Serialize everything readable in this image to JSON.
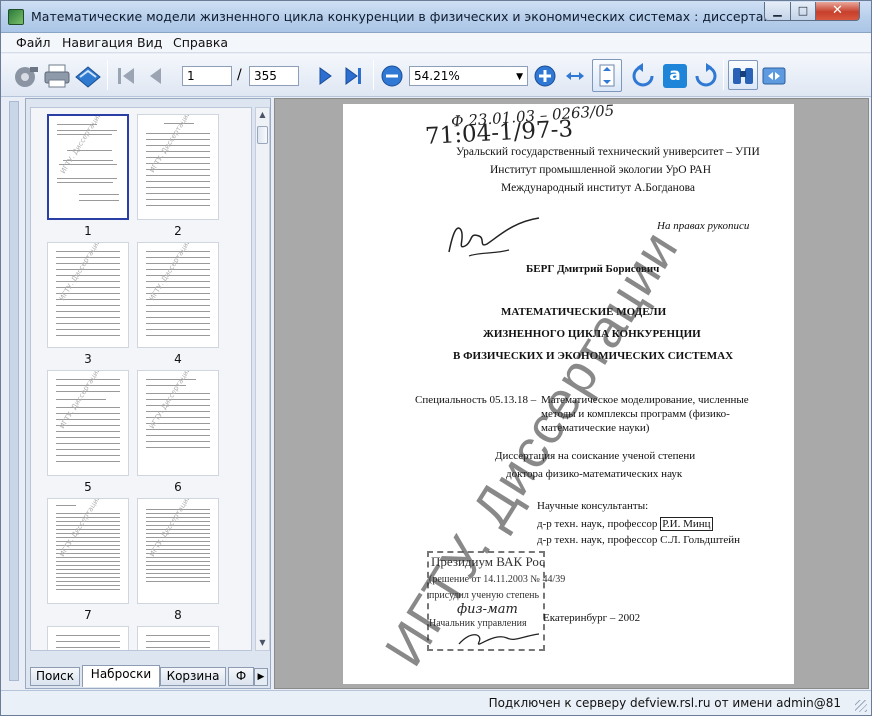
{
  "window": {
    "title": "Математические модели жизненного цикла конкуренции в физических и экономических системах : диссертация ... доктора физи..."
  },
  "menu": {
    "items": [
      "Файл",
      "Навигация",
      "Вид",
      "Справка"
    ]
  },
  "toolbar": {
    "page_current": "1",
    "page_separator": "/",
    "page_total": "355",
    "zoom": "54.21%",
    "icons": [
      "open-tool-icon",
      "print-icon",
      "send-icon",
      "first-page-icon",
      "prev-page-icon",
      "next-page-icon",
      "last-page-icon",
      "zoom-out-icon",
      "zoom-in-icon",
      "fit-width-icon",
      "fit-page-icon",
      "rotate-left-icon",
      "text-select-icon",
      "rotate-right-icon",
      "binoculars-icon",
      "compare-icon"
    ]
  },
  "thumbnails": {
    "numbers": [
      "1",
      "2",
      "3",
      "4",
      "5",
      "6",
      "7",
      "8"
    ],
    "selected": "1",
    "watermark": "ИГТУ. Диссертации"
  },
  "tabs": [
    "Поиск",
    "Наброски",
    "Корзина",
    "Ф"
  ],
  "active_tab": "Наброски",
  "document": {
    "handwritten_code_1": "Ф 23.01.03 – 0263/05",
    "handwritten_code_2": "71:04-1/97-3",
    "org_1": "Уральский государственный технический университет – УПИ",
    "org_2": "Институт промышленной экологии УрО РАН",
    "org_3": "Международный институт А.Богданова",
    "rights": "На правах рукописи",
    "author": "БЕРГ Дмитрий Борисович",
    "title_1": "МАТЕМАТИЧЕСКИЕ МОДЕЛИ",
    "title_2": "ЖИЗНЕННОГО ЦИКЛА КОНКУРЕНЦИИ",
    "title_3": "В ФИЗИЧЕСКИХ И ЭКОНОМИЧЕСКИХ СИСТЕМАХ",
    "specialty_label": "Специальность 05.13.18 –",
    "specialty_1": "Математическое моделирование, численные",
    "specialty_2": "методы и комплексы программ (физико-",
    "specialty_3": "математические науки)",
    "degree_1": "Диссертация на соискание ученой степени",
    "degree_2": "доктора физико-математических наук",
    "consultants_label": "Научные консультанты:",
    "consultant_1_prefix": "д-р техн. наук, профессор",
    "consultant_1_name": "Р.И. Минц",
    "consultant_2": "д-р техн. наук, профессор С.Л. Гольдштейн",
    "stamp_1": "Президиум ВАК Рос",
    "stamp_2": "(решение от 14.11.2003 № 44/39",
    "stamp_3": "присудил ученую степень",
    "stamp_4": "физ-мат",
    "stamp_5": "Начальник управления",
    "city_year": "Екатеринбург – 2002",
    "watermark": "ИГТУ. Диссертации"
  },
  "status": {
    "text": "Подключен к серверу defview.rsl.ru от имени admin@81"
  }
}
